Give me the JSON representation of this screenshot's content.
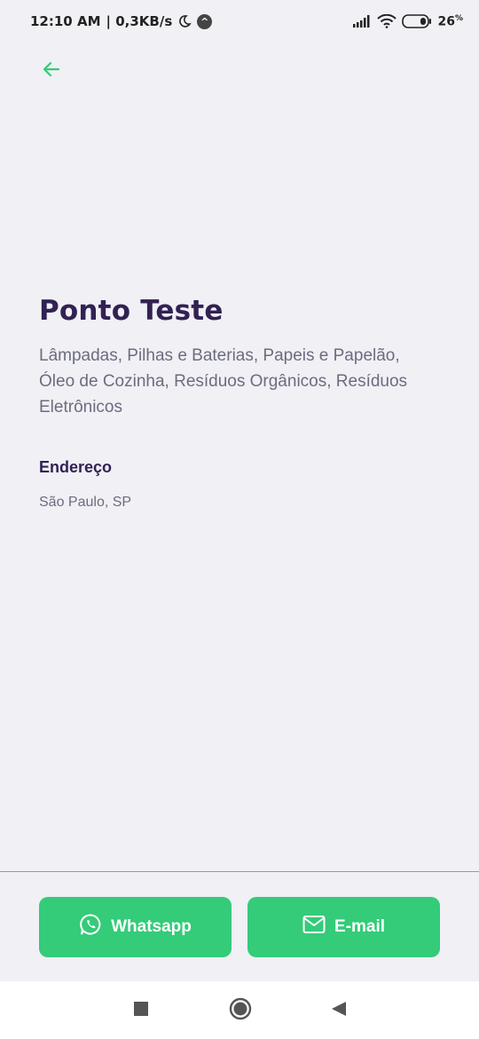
{
  "status_bar": {
    "time": "12:10 AM",
    "speed": "| 0,3KB/s",
    "circle_glyph": "^",
    "battery": "26",
    "battery_unit": "%"
  },
  "point": {
    "name": "Ponto Teste",
    "items": "Lâmpadas, Pilhas e Baterias, Papeis e Papelão, Óleo de Cozinha, Resíduos Orgânicos, Resíduos Eletrônicos"
  },
  "address": {
    "title": "Endereço",
    "value": "São Paulo, SP"
  },
  "footer": {
    "whatsapp_label": "Whatsapp",
    "email_label": "E-mail"
  },
  "icons": {
    "back": "arrow-left-icon",
    "whatsapp": "whatsapp-icon",
    "email": "mail-icon",
    "nav_recents": "square-icon",
    "nav_home": "circle-icon",
    "nav_back": "triangle-back-icon"
  },
  "colors": {
    "background": "#f0f0f5",
    "primary_green": "#34cb79",
    "title": "#322153",
    "text": "#6c6c80"
  }
}
